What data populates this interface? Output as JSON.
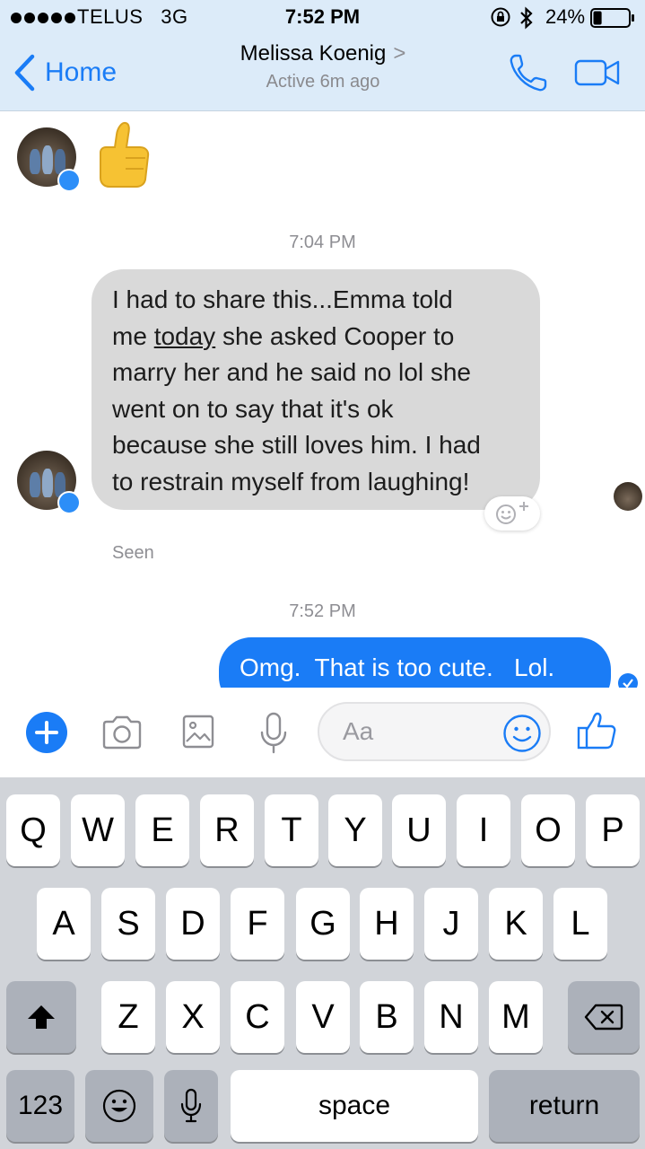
{
  "status_bar": {
    "carrier": "TELUS",
    "network": "3G",
    "time": "7:52 PM",
    "battery_percent": "24%",
    "battery_level": 0.24,
    "icons": [
      "signal-dots-icon",
      "rotation-lock-icon",
      "bluetooth-icon",
      "battery-icon"
    ]
  },
  "nav": {
    "back_label": "Home",
    "contact_name": "Melissa Koenig",
    "contact_chevron": ">",
    "contact_status": "Active 6m ago",
    "accent_color": "#1a7cf6",
    "icons": [
      "back-chevron-icon",
      "phone-icon",
      "video-camera-icon"
    ]
  },
  "conversation": {
    "sticker": "thumbs-up-emoji",
    "timestamp_1": "7:04 PM",
    "incoming_message": {
      "line1": "I had to share this...Emma told",
      "line2_prefix": "me ",
      "line2_underlined": "today",
      "line2_suffix": " she asked Cooper to",
      "line3": "marry her and he said no lol she",
      "line4": "went on to say that it's ok",
      "line5": "because she still loves him. I had",
      "line6": "to restrain myself from laughing!"
    },
    "seen_label": "Seen",
    "timestamp_2": "7:52 PM",
    "outgoing_message": "Omg.  That is too cute.   Lol.",
    "incoming_bubble_color": "#d9d9d9",
    "outgoing_bubble_color": "#1a7cf6"
  },
  "composer": {
    "placeholder": "Aa",
    "icons": [
      "plus-icon",
      "camera-icon",
      "gallery-icon",
      "microphone-icon",
      "emoji-icon",
      "thumbs-up-icon"
    ]
  },
  "keyboard": {
    "row1": [
      "Q",
      "W",
      "E",
      "R",
      "T",
      "Y",
      "U",
      "I",
      "O",
      "P"
    ],
    "row2": [
      "A",
      "S",
      "D",
      "F",
      "G",
      "H",
      "J",
      "K",
      "L"
    ],
    "row3": [
      "Z",
      "X",
      "C",
      "V",
      "B",
      "N",
      "M"
    ],
    "numbers_label": "123",
    "space_label": "space",
    "return_label": "return"
  }
}
